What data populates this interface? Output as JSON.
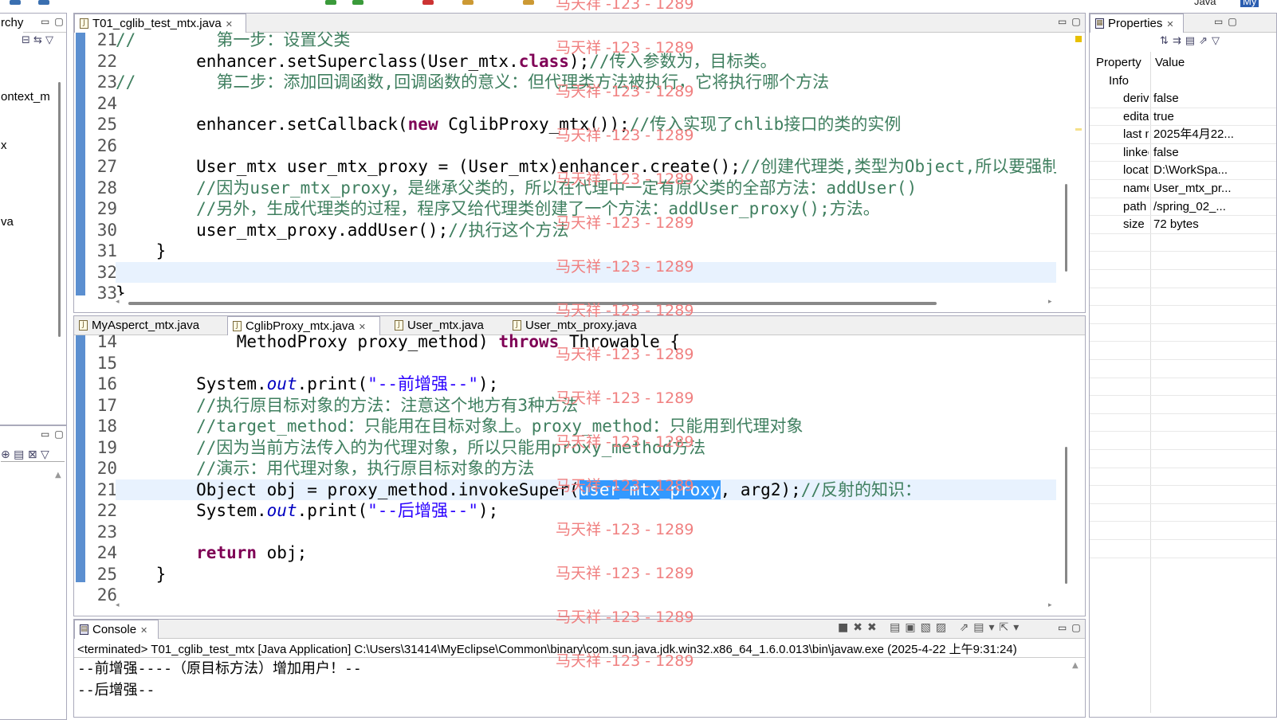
{
  "perspective": {
    "label": "Java",
    "label2": "My"
  },
  "left_panel": {
    "title": "rchy",
    "items": [
      "ontext_m",
      "x",
      "va"
    ]
  },
  "editor1": {
    "tab_label": "T01_cglib_test_mtx.java",
    "line_numbers": [
      "21",
      "22",
      "23",
      "24",
      "25",
      "26",
      "27",
      "28",
      "29",
      "30",
      "31",
      "32",
      "33"
    ],
    "lines": [
      [
        {
          "t": "//        ",
          "c": "cm"
        },
        {
          "t": "第一步：设置父类",
          "c": "cm"
        }
      ],
      [
        {
          "t": "        enhancer.setSuperclass(User_mtx.",
          "c": ""
        },
        {
          "t": "class",
          "c": "kw"
        },
        {
          "t": ");",
          "c": ""
        },
        {
          "t": "//传入参数为，目标类。",
          "c": "cm"
        }
      ],
      [
        {
          "t": "//        ",
          "c": "cm"
        },
        {
          "t": "第二步：添加回调函数,回调函数的意义：但代理类方法被执行，它将执行哪个方法",
          "c": "cm"
        }
      ],
      [
        {
          "t": "",
          "c": ""
        }
      ],
      [
        {
          "t": "        enhancer.setCallback(",
          "c": ""
        },
        {
          "t": "new",
          "c": "kw"
        },
        {
          "t": " CglibProxy_mtx());",
          "c": ""
        },
        {
          "t": "//传入实现了chlib接口的类的实例",
          "c": "cm"
        }
      ],
      [
        {
          "t": "",
          "c": ""
        }
      ],
      [
        {
          "t": "        User_mtx user_mtx_proxy = (User_mtx)enhancer.create();",
          "c": ""
        },
        {
          "t": "//创建代理类,类型为Object,所以要强制类型",
          "c": "cm"
        }
      ],
      [
        {
          "t": "        //因为user_mtx_proxy，是继承父类的，所以在代理中一定有原父类的全部方法：addUser()",
          "c": "cm"
        }
      ],
      [
        {
          "t": "        //另外，生成代理类的过程，程序又给代理类创建了一个方法：addUser_proxy();方法。",
          "c": "cm"
        }
      ],
      [
        {
          "t": "        user_mtx_proxy.addUser();",
          "c": ""
        },
        {
          "t": "//执行这个方法",
          "c": "cm"
        }
      ],
      [
        {
          "t": "    }",
          "c": ""
        }
      ],
      [
        {
          "t": "",
          "c": ""
        }
      ],
      [
        {
          "t": "}",
          "c": ""
        }
      ]
    ]
  },
  "editor2": {
    "tabs": [
      "MyAsperct_mtx.java",
      "CglibProxy_mtx.java",
      "User_mtx.java",
      "User_mtx_proxy.java"
    ],
    "active_tab": 1,
    "line_numbers": [
      "14",
      "15",
      "16",
      "17",
      "18",
      "19",
      "20",
      "21",
      "22",
      "23",
      "24",
      "25",
      "26"
    ],
    "lines": [
      [
        {
          "t": "            MethodProxy proxy_method) ",
          "c": ""
        },
        {
          "t": "throws",
          "c": "kw"
        },
        {
          "t": " Throwable {",
          "c": ""
        }
      ],
      [
        {
          "t": "",
          "c": ""
        }
      ],
      [
        {
          "t": "        System.",
          "c": ""
        },
        {
          "t": "out",
          "c": "fi"
        },
        {
          "t": ".print(",
          "c": ""
        },
        {
          "t": "\"--前增强--\"",
          "c": "st"
        },
        {
          "t": ");",
          "c": ""
        }
      ],
      [
        {
          "t": "        //执行原目标对象的方法：注意这个地方有3种方法",
          "c": "cm"
        }
      ],
      [
        {
          "t": "        //target_method：只能用在目标对象上。proxy_method：只能用到代理对象",
          "c": "cm"
        }
      ],
      [
        {
          "t": "        //因为当前方法传入的为代理对象，所以只能用proxy_method方法",
          "c": "cm"
        }
      ],
      [
        {
          "t": "        //演示：用代理对象，执行原目标对象的方法",
          "c": "cm"
        }
      ],
      [
        {
          "t": "        Object obj = proxy_method.invokeSuper(",
          "c": ""
        },
        {
          "t": "user_mtx_proxy",
          "c": "sel"
        },
        {
          "t": ", arg2);",
          "c": ""
        },
        {
          "t": "//反射的知识：",
          "c": "cm"
        }
      ],
      [
        {
          "t": "        System.",
          "c": ""
        },
        {
          "t": "out",
          "c": "fi"
        },
        {
          "t": ".print(",
          "c": ""
        },
        {
          "t": "\"--后增强--\"",
          "c": "st"
        },
        {
          "t": ");",
          "c": ""
        }
      ],
      [
        {
          "t": "",
          "c": ""
        }
      ],
      [
        {
          "t": "        ",
          "c": ""
        },
        {
          "t": "return",
          "c": "kw"
        },
        {
          "t": " obj;",
          "c": ""
        }
      ],
      [
        {
          "t": "    }",
          "c": ""
        }
      ],
      [
        {
          "t": "",
          "c": ""
        }
      ]
    ]
  },
  "properties": {
    "tab_label": "Properties",
    "col_property": "Property",
    "col_value": "Value",
    "group": "Info",
    "rows": [
      {
        "k": "derived",
        "v": "false"
      },
      {
        "k": "editable",
        "v": "true"
      },
      {
        "k": "last modified",
        "v": "2025年4月22..."
      },
      {
        "k": "linked",
        "v": "false"
      },
      {
        "k": "location",
        "v": "D:\\WorkSpa..."
      },
      {
        "k": "name",
        "v": "User_mtx_pr..."
      },
      {
        "k": "path",
        "v": "/spring_02_..."
      },
      {
        "k": "size",
        "v": "72  bytes"
      }
    ]
  },
  "console": {
    "tab_label": "Console",
    "status": "<terminated> T01_cglib_test_mtx [Java Application] C:\\Users\\31414\\MyEclipse\\Common\\binary\\com.sun.java.jdk.win32.x86_64_1.6.0.013\\bin\\javaw.exe (2025-4-22 上午9:31:24)",
    "output": [
      "--前增强----（原目标方法）增加用户！--",
      "--后增强--"
    ]
  },
  "watermark": "马天祥 -123 - 1289"
}
